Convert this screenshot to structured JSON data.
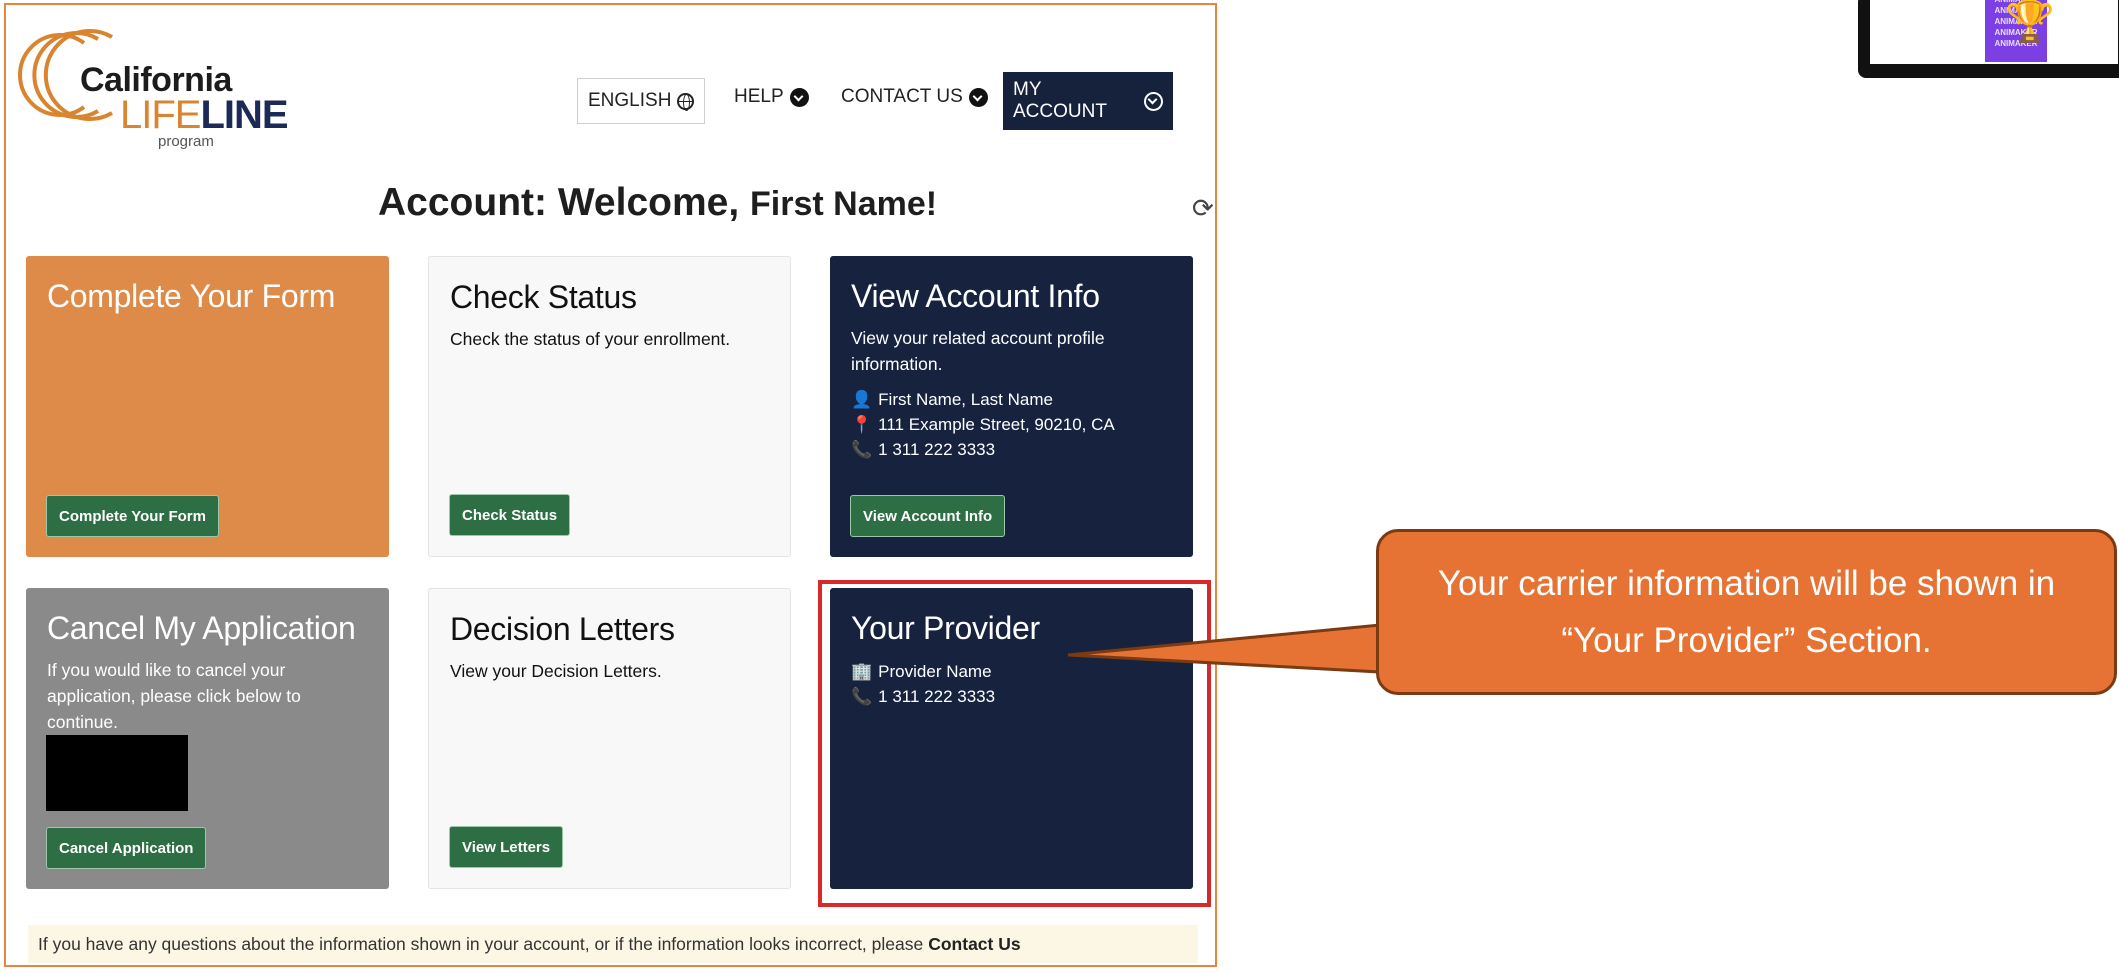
{
  "logo": {
    "california": "California",
    "life": "LIFE",
    "line": "LINE",
    "program": "program"
  },
  "nav": {
    "english": "ENGLISH",
    "help": "HELP",
    "contact": "CONTACT US",
    "account": "MY ACCOUNT"
  },
  "header": {
    "title_prefix": "Account: Welcome,",
    "title_name": "First Name!"
  },
  "cards": {
    "complete": {
      "title": "Complete Your Form",
      "button": "Complete Your Form"
    },
    "status": {
      "title": "Check Status",
      "description": "Check the status of your enrollment.",
      "button": "Check Status"
    },
    "account_info": {
      "title": "View Account Info",
      "description": "View your related account profile information.",
      "name": "First Name, Last Name",
      "address": "111 Example Street, 90210, CA",
      "phone": "1 311 222 3333",
      "button": "View Account Info"
    },
    "cancel": {
      "title": "Cancel My Application",
      "description": "If you would like to cancel your application, please click below to continue.",
      "button": "Cancel Application"
    },
    "letters": {
      "title": "Decision Letters",
      "description": "View your Decision Letters.",
      "button": "View Letters"
    },
    "provider": {
      "title": "Your Provider",
      "name": "Provider Name",
      "phone": "1 311 222 3333"
    }
  },
  "footer": {
    "text": "If you have any questions about the information shown in your account, or if the information looks incorrect, please",
    "link": "Contact Us"
  },
  "callout": {
    "text": "Your carrier information will be shown in “Your Provider” Section."
  },
  "thumbnail": {
    "text": "ANIMAKER ANIMAKER ANIMAKER ANIMAKER ANIMAKER"
  },
  "colors": {
    "orange": "#de8a48",
    "navy": "#16223e",
    "green_button": "#2e6e44",
    "highlight_red": "#d8282c",
    "callout": "#e67234"
  }
}
